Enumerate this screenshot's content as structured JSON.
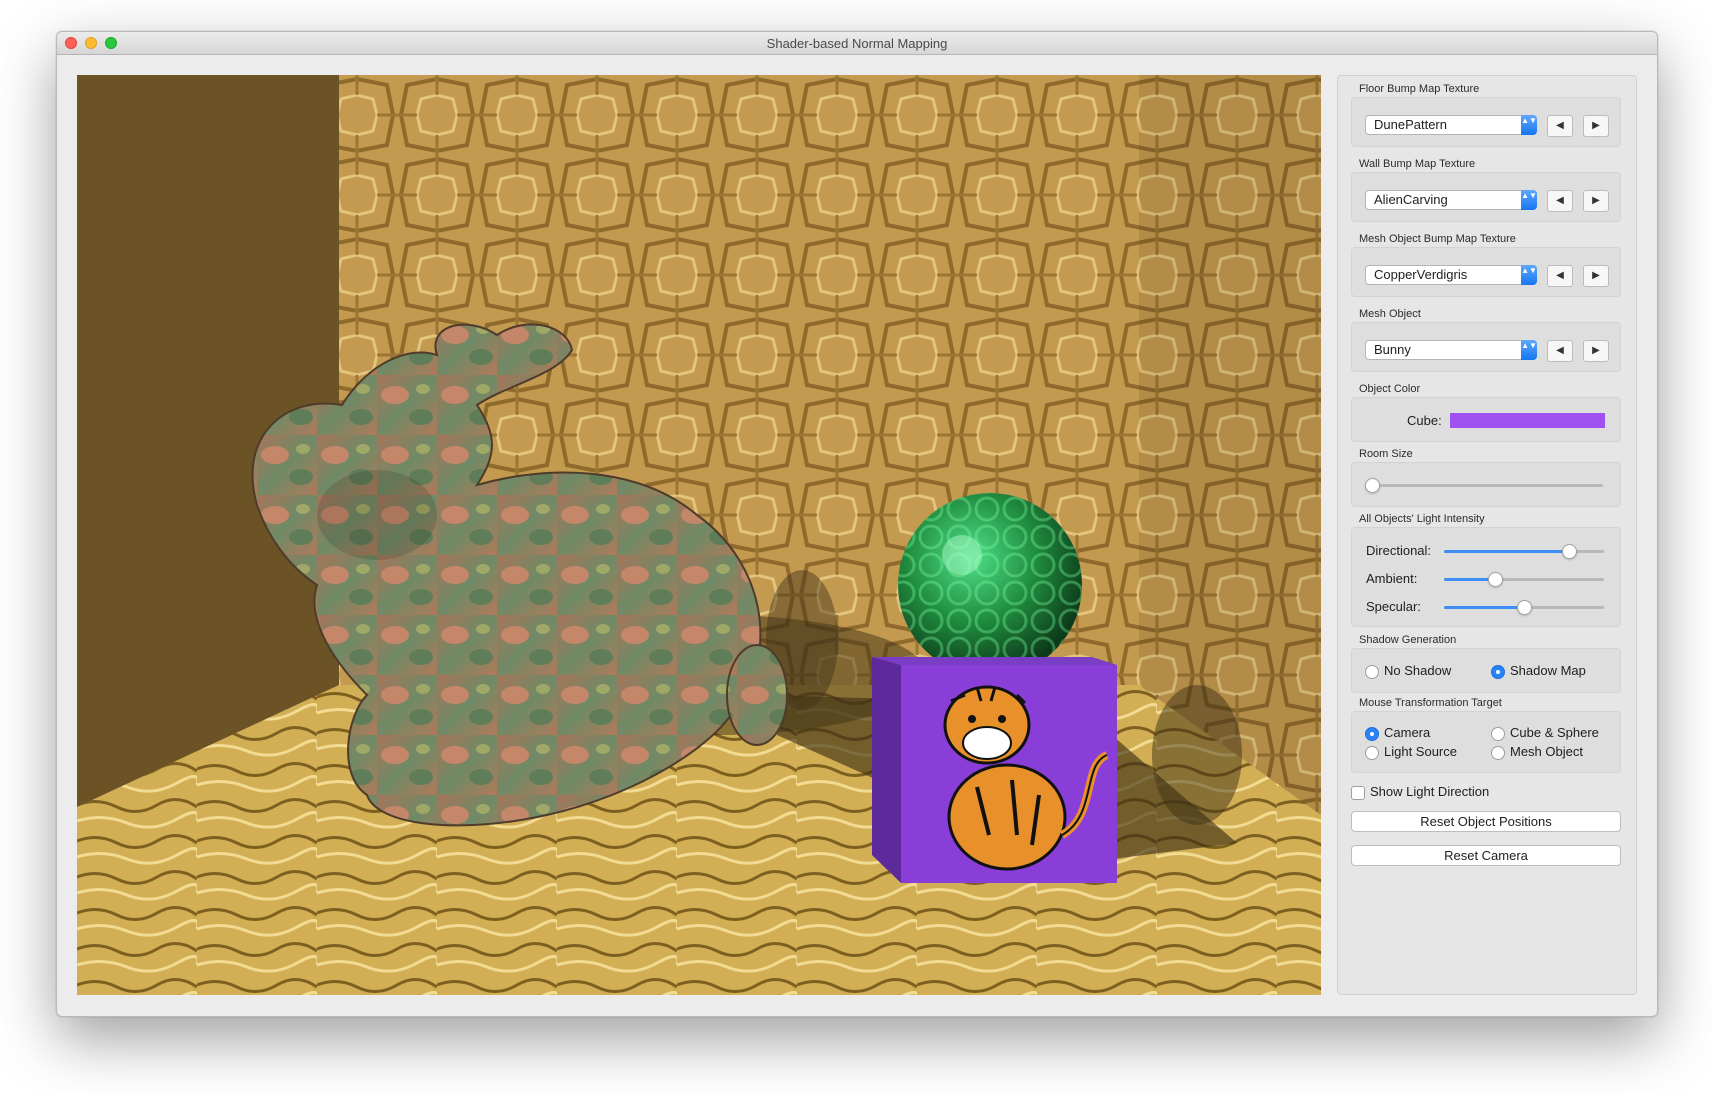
{
  "window": {
    "title": "Shader-based Normal Mapping"
  },
  "colors": {
    "accent": "#2a83f6",
    "cube_color": "#a052f0",
    "floor": "#caa64a",
    "wall": "#b88f45",
    "left_wall": "#6b5326"
  },
  "panel": {
    "floor_bump": {
      "label": "Floor Bump Map Texture",
      "value": "DunePattern"
    },
    "wall_bump": {
      "label": "Wall Bump Map Texture",
      "value": "AlienCarving"
    },
    "mesh_bump": {
      "label": "Mesh Object Bump Map Texture",
      "value": "CopperVerdigris"
    },
    "mesh_object": {
      "label": "Mesh Object",
      "value": "Bunny"
    },
    "object_color": {
      "label": "Object Color",
      "cube_label": "Cube:"
    },
    "room_size": {
      "label": "Room Size",
      "value": 0.0
    },
    "light_intensity": {
      "label": "All Objects' Light Intensity",
      "directional_label": "Directional:",
      "directional_value": 0.78,
      "ambient_label": "Ambient:",
      "ambient_value": 0.32,
      "specular_label": "Specular:",
      "specular_value": 0.5
    },
    "shadow": {
      "label": "Shadow Generation",
      "no_shadow": "No Shadow",
      "shadow_map": "Shadow Map",
      "selected": "shadow_map"
    },
    "mouse_target": {
      "label": "Mouse Transformation Target",
      "camera": "Camera",
      "cube_sphere": "Cube & Sphere",
      "light_source": "Light Source",
      "mesh_object": "Mesh Object",
      "selected": "camera"
    },
    "show_light_direction": {
      "label": "Show Light Direction",
      "checked": false
    },
    "reset_positions": "Reset Object Positions",
    "reset_camera": "Reset Camera"
  },
  "icons": {
    "prev": "◀",
    "next": "▶",
    "combo_arrow": "▲▼"
  }
}
